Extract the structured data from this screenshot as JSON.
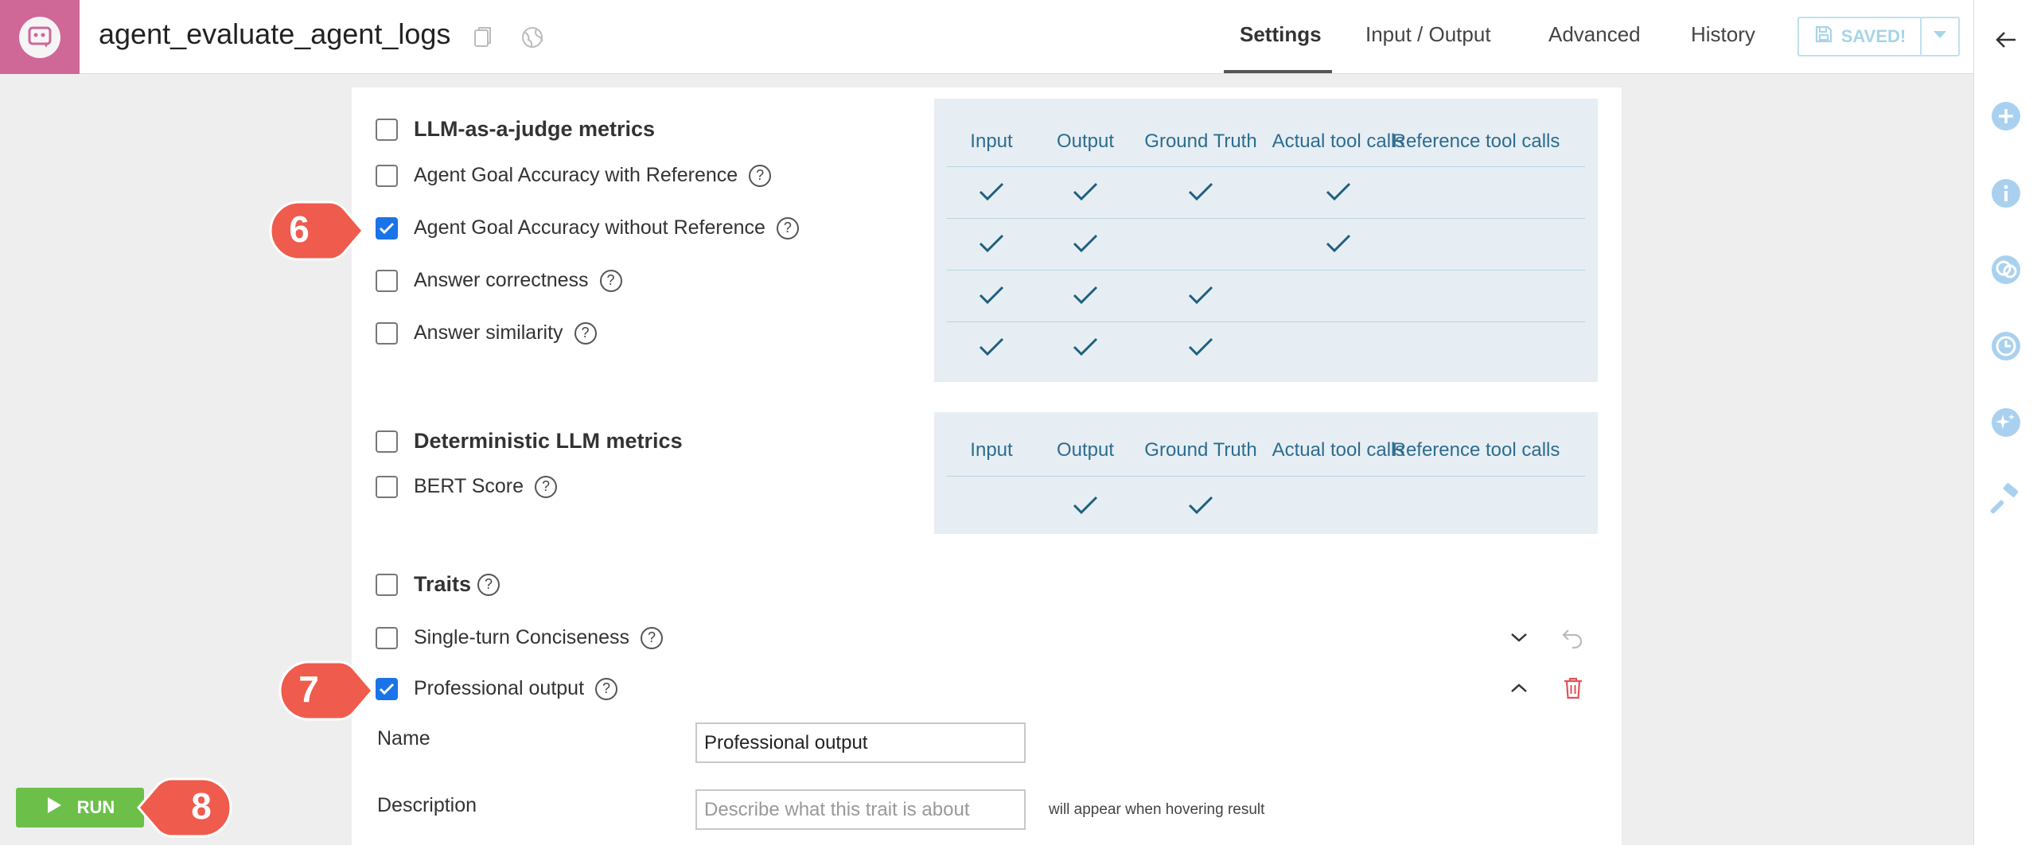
{
  "header": {
    "title": "agent_evaluate_agent_logs",
    "tabs": [
      {
        "label": "Settings",
        "active": true
      },
      {
        "label": "Input / Output"
      },
      {
        "label": "Advanced"
      },
      {
        "label": "History"
      }
    ],
    "saved_label": "SAVED!"
  },
  "table_columns": [
    "Input",
    "Output",
    "Ground Truth",
    "Actual tool calls",
    "Reference tool calls"
  ],
  "llm_judge": {
    "title": "LLM-as-a-judge metrics",
    "metrics": [
      {
        "label": "Agent Goal Accuracy with Reference",
        "checked": false,
        "requires": [
          true,
          true,
          true,
          true,
          false
        ]
      },
      {
        "label": "Agent Goal Accuracy without Reference",
        "checked": true,
        "requires": [
          true,
          true,
          false,
          true,
          false
        ]
      },
      {
        "label": "Answer correctness",
        "checked": false,
        "requires": [
          true,
          true,
          true,
          false,
          false
        ]
      },
      {
        "label": "Answer similarity",
        "checked": false,
        "requires": [
          true,
          true,
          true,
          false,
          false
        ]
      }
    ]
  },
  "deterministic": {
    "title": "Deterministic LLM metrics",
    "metrics": [
      {
        "label": "BERT Score",
        "checked": false,
        "requires": [
          false,
          true,
          true,
          false,
          false
        ]
      }
    ]
  },
  "traits": {
    "title": "Traits",
    "items": [
      {
        "label": "Single-turn Conciseness",
        "checked": false
      },
      {
        "label": "Professional output",
        "checked": true
      }
    ],
    "name_label": "Name",
    "name_value": "Professional output",
    "description_label": "Description",
    "description_placeholder": "Describe what this trait is about",
    "description_hint": "will appear when hovering result"
  },
  "run_label": "RUN",
  "callouts": [
    "6",
    "7",
    "8"
  ],
  "colors": {
    "accent": "#1b73e8",
    "logo_bg": "#cf6797",
    "run_green": "#6cc04a",
    "callout_red": "#ef5b4c",
    "table_bg": "#e6eef3",
    "check_color": "#1f5f7f",
    "delete_red": "#e0525a"
  }
}
